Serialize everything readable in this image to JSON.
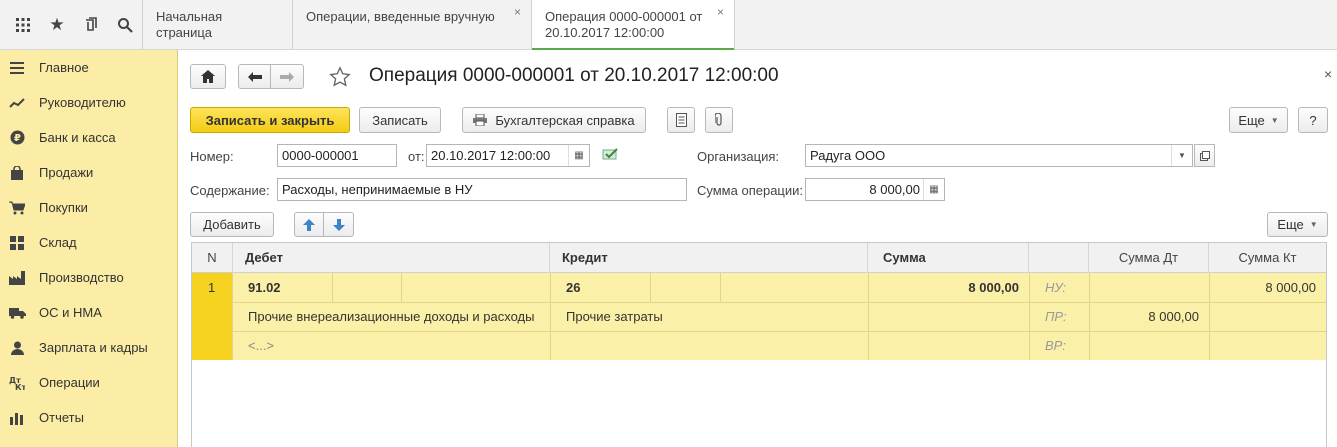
{
  "tabs": [
    {
      "label": "Начальная страница"
    },
    {
      "label": "Операции, введенные вручную"
    },
    {
      "label_line1": "Операция 0000-000001 от",
      "label_line2": "20.10.2017 12:00:00"
    }
  ],
  "sidebar": {
    "items": [
      {
        "label": "Главное",
        "icon": "menu-lines-icon"
      },
      {
        "label": "Руководителю",
        "icon": "trend-chart-icon"
      },
      {
        "label": "Банк и касса",
        "icon": "ruble-coin-icon"
      },
      {
        "label": "Продажи",
        "icon": "shopping-bag-icon"
      },
      {
        "label": "Покупки",
        "icon": "cart-icon"
      },
      {
        "label": "Склад",
        "icon": "warehouse-grid-icon"
      },
      {
        "label": "Производство",
        "icon": "factory-icon"
      },
      {
        "label": "ОС и НМА",
        "icon": "truck-icon"
      },
      {
        "label": "Зарплата и кадры",
        "icon": "person-icon"
      },
      {
        "label": "Операции",
        "icon": "dt-kt-icon"
      },
      {
        "label": "Отчеты",
        "icon": "bar-chart-icon"
      }
    ]
  },
  "form": {
    "title": "Операция 0000-000001 от 20.10.2017 12:00:00",
    "buttons": {
      "save_close": "Записать и закрыть",
      "save": "Записать",
      "report": "Бухгалтерская справка",
      "more": "Еще",
      "help": "?",
      "add": "Добавить",
      "more_table": "Еще"
    },
    "fields": {
      "number_label": "Номер:",
      "number_value": "0000-000001",
      "date_label": "от:",
      "date_value": "20.10.2017 12:00:00",
      "org_label": "Организация:",
      "org_value": "Радуга ООО",
      "content_label": "Содержание:",
      "content_value": "Расходы, непринимаемые в НУ",
      "sum_label": "Сумма операции:",
      "sum_value": "8 000,00"
    }
  },
  "table": {
    "headers": {
      "n": "N",
      "debit": "Дебет",
      "credit": "Кредит",
      "sum": "Сумма",
      "sum_dt": "Сумма Дт",
      "sum_kt": "Сумма Кт"
    },
    "row": {
      "n": "1",
      "debit_account": "91.02",
      "credit_account": "26",
      "sum": "8 000,00",
      "debit_subconto": "Прочие внереализационные доходы и расходы",
      "credit_subconto": "Прочие затраты",
      "debit_subconto2": "<...>",
      "nu_label": "НУ:",
      "pr_label": "ПР:",
      "vr_label": "ВР:",
      "sum_kt_nu": "8 000,00",
      "sum_dt_pr": "8 000,00"
    }
  }
}
